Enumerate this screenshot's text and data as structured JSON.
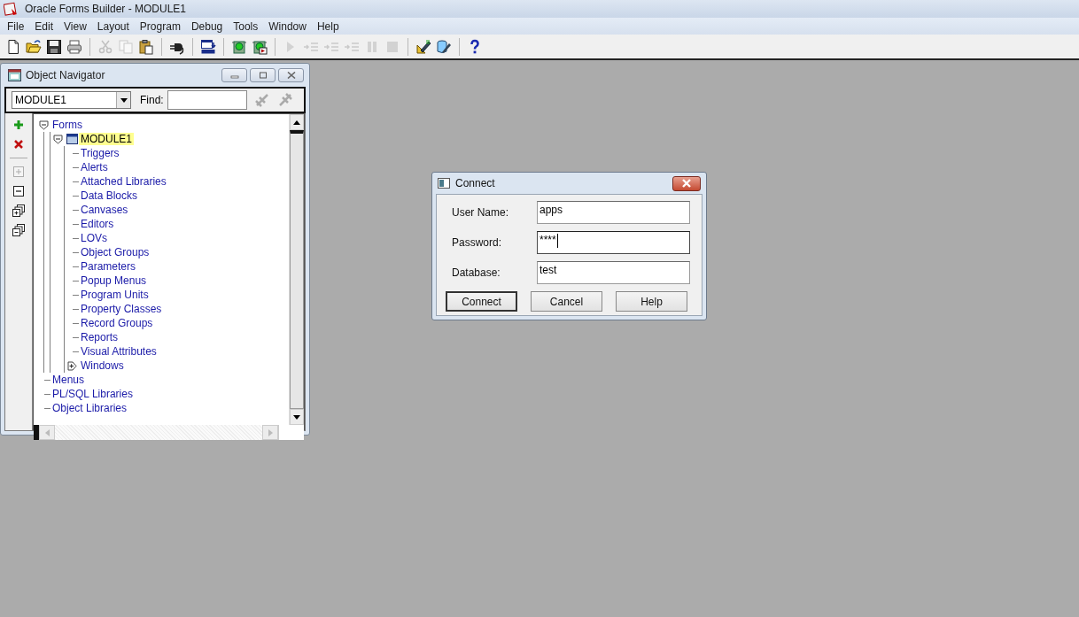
{
  "window": {
    "title": "Oracle Forms Builder - MODULE1"
  },
  "menu": [
    "File",
    "Edit",
    "View",
    "Layout",
    "Program",
    "Debug",
    "Tools",
    "Window",
    "Help"
  ],
  "toolbar": [
    {
      "kind": "button",
      "disabled": false
    },
    {
      "kind": "button",
      "disabled": false
    },
    {
      "kind": "button",
      "disabled": false
    },
    {
      "kind": "button",
      "disabled": false
    },
    {
      "kind": "separator"
    },
    {
      "kind": "button",
      "disabled": true
    },
    {
      "kind": "button",
      "disabled": true
    },
    {
      "kind": "button",
      "disabled": false
    },
    {
      "kind": "separator"
    },
    {
      "kind": "button",
      "disabled": false
    },
    {
      "kind": "separator"
    },
    {
      "kind": "button",
      "disabled": false
    },
    {
      "kind": "separator"
    },
    {
      "kind": "button",
      "disabled": false
    },
    {
      "kind": "button",
      "disabled": false
    },
    {
      "kind": "separator"
    },
    {
      "kind": "button",
      "disabled": true
    },
    {
      "kind": "button",
      "disabled": true
    },
    {
      "kind": "button",
      "disabled": true
    },
    {
      "kind": "button",
      "disabled": true
    },
    {
      "kind": "button",
      "disabled": true
    },
    {
      "kind": "button",
      "disabled": true
    },
    {
      "kind": "separator"
    },
    {
      "kind": "button",
      "disabled": false
    },
    {
      "kind": "button",
      "disabled": false
    },
    {
      "kind": "separator"
    },
    {
      "kind": "button",
      "disabled": false
    }
  ],
  "navigator": {
    "title": "Object Navigator",
    "module_select": "MODULE1",
    "find_label": "Find:",
    "side_tools": [
      {
        "kind": "create",
        "disabled": false
      },
      {
        "kind": "delete",
        "disabled": false
      },
      {
        "kind": "expand",
        "disabled": true
      },
      {
        "kind": "collapse",
        "disabled": false
      },
      {
        "kind": "expand-all",
        "disabled": false
      },
      {
        "kind": "collapse-all",
        "disabled": false
      }
    ],
    "tree": [
      {
        "label": "Forms",
        "expanded": true,
        "selected": false,
        "children": [
          {
            "label": "MODULE1",
            "expanded": true,
            "selected": true,
            "children": [
              {
                "label": "Triggers"
              },
              {
                "label": "Alerts"
              },
              {
                "label": "Attached Libraries"
              },
              {
                "label": "Data Blocks"
              },
              {
                "label": "Canvases"
              },
              {
                "label": "Editors"
              },
              {
                "label": "LOVs"
              },
              {
                "label": "Object Groups"
              },
              {
                "label": "Parameters"
              },
              {
                "label": "Popup Menus"
              },
              {
                "label": "Program Units"
              },
              {
                "label": "Property Classes"
              },
              {
                "label": "Record Groups"
              },
              {
                "label": "Reports"
              },
              {
                "label": "Visual Attributes"
              },
              {
                "label": "Windows",
                "expanded": false,
                "selected": false
              }
            ]
          }
        ]
      },
      {
        "label": "Menus"
      },
      {
        "label": "PL/SQL Libraries"
      },
      {
        "label": "Object Libraries"
      }
    ]
  },
  "dialog": {
    "title": "Connect",
    "fields": [
      {
        "label": "User Name:",
        "value": "apps",
        "focused": false
      },
      {
        "label": "Password:",
        "value": "****",
        "focused": true
      },
      {
        "label": "Database:",
        "value": "test",
        "focused": false
      }
    ],
    "buttons": [
      {
        "label": "Connect",
        "default": true
      },
      {
        "label": "Cancel",
        "default": false
      },
      {
        "label": "Help",
        "default": false
      }
    ]
  }
}
